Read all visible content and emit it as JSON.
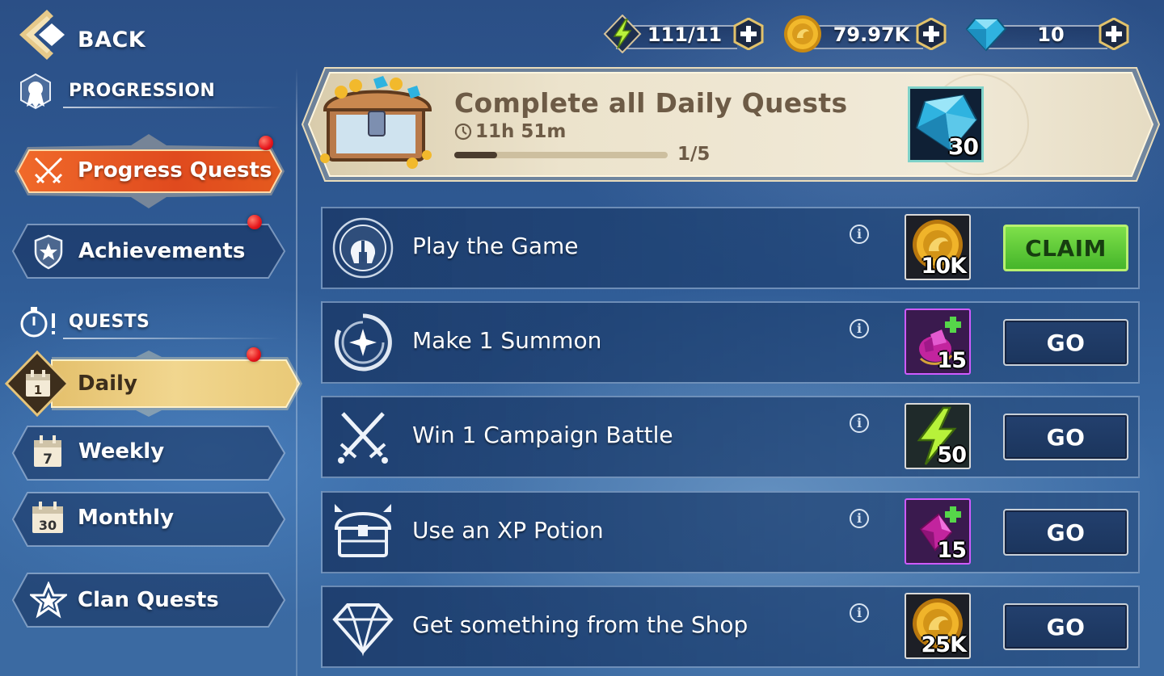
{
  "nav": {
    "back_label": "BACK",
    "progression_heading": "PROGRESSION",
    "quests_heading": "QUESTS",
    "items": [
      {
        "label": "Progress Quests",
        "state": "active-orange",
        "badge": true
      },
      {
        "label": "Achievements",
        "state": "normal",
        "badge": true
      },
      {
        "label": "Daily",
        "state": "selected",
        "badge": true,
        "calendar_number": "1"
      },
      {
        "label": "Weekly",
        "state": "normal",
        "badge": false,
        "calendar_number": "7"
      },
      {
        "label": "Monthly",
        "state": "normal",
        "badge": false,
        "calendar_number": "30"
      },
      {
        "label": "Clan Quests",
        "state": "normal",
        "badge": false
      }
    ]
  },
  "currencies": [
    {
      "icon": "energy-icon",
      "value": "111/11"
    },
    {
      "icon": "gold-coin-icon",
      "value": "79.97K"
    },
    {
      "icon": "gem-icon",
      "value": "10"
    }
  ],
  "banner": {
    "title": "Complete all Daily Quests",
    "timer": "11h 51m",
    "progress_text": "1/5",
    "progress_fraction": 0.2,
    "reward_icon": "gem-icon",
    "reward_amount": "30"
  },
  "quests": [
    {
      "title": "Play the Game",
      "icon": "helmet-icon",
      "reward_icon": "gold-coin-icon",
      "reward_amount": "10K",
      "button": "CLAIM"
    },
    {
      "title": "Make 1 Summon",
      "icon": "summon-star-icon",
      "reward_icon": "purple-shard-icon",
      "reward_amount": "15",
      "button": "GO"
    },
    {
      "title": "Win 1 Campaign Battle",
      "icon": "crossed-swords-icon",
      "reward_icon": "energy-icon",
      "reward_amount": "50",
      "button": "GO"
    },
    {
      "title": "Use an XP Potion",
      "icon": "treasure-chest-icon",
      "reward_icon": "purple-crystal-icon",
      "reward_amount": "15",
      "button": "GO"
    },
    {
      "title": "Get something from the Shop",
      "icon": "diamond-icon",
      "reward_icon": "gold-coin-icon",
      "reward_amount": "25K",
      "button": "GO"
    }
  ],
  "colors": {
    "claim_green": "#5cc936",
    "active_orange": "#e8541f",
    "selected_gold": "#e7c879",
    "badge_red": "#e5151b"
  }
}
